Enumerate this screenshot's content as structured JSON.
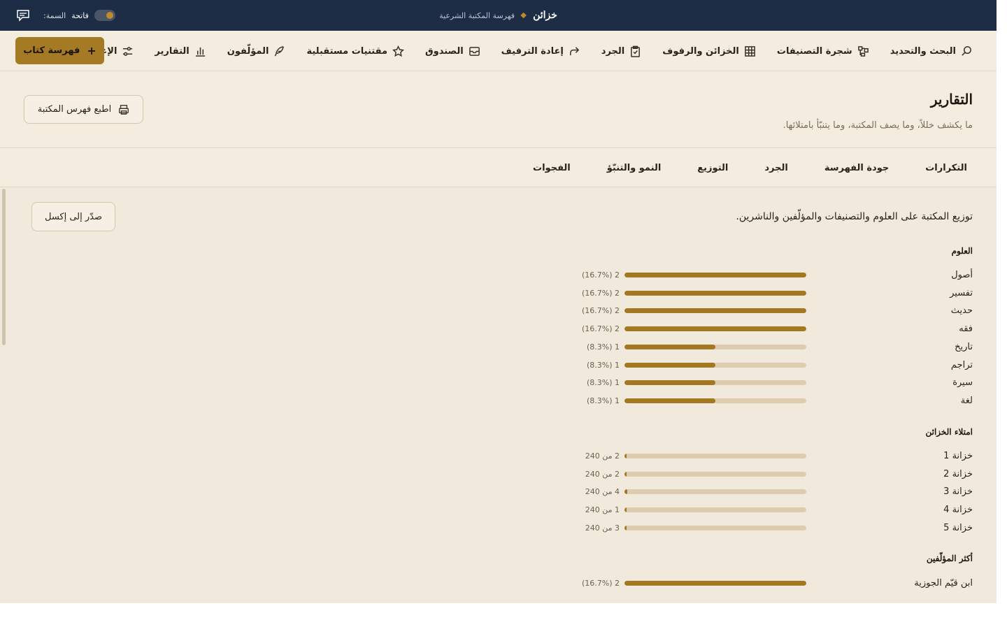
{
  "topbar": {
    "brand_name": "خزائن",
    "brand_subtitle": "فهرسة المكتبة الشرعية",
    "theme_label": "السمة:",
    "theme_value": "فاتحة"
  },
  "nav": {
    "items": [
      {
        "label": "البحث والتحديد",
        "icon": "search-icon"
      },
      {
        "label": "شجرة التصنيفات",
        "icon": "tree-icon"
      },
      {
        "label": "الخزائن والرفوف",
        "icon": "grid-icon"
      },
      {
        "label": "الجرد",
        "icon": "clipboard-check-icon"
      },
      {
        "label": "إعادة الترفيف",
        "icon": "redo-arrow-icon"
      },
      {
        "label": "الصندوق",
        "icon": "inbox-icon"
      },
      {
        "label": "مقتنيات مستقبلية",
        "icon": "star-icon"
      },
      {
        "label": "المؤلّفون",
        "icon": "quill-icon"
      },
      {
        "label": "التقارير",
        "icon": "bar-chart-icon"
      },
      {
        "label": "الإعدادات",
        "icon": "sliders-icon"
      }
    ],
    "primary_button": "فهرسة كتاب"
  },
  "page": {
    "title": "التقارير",
    "subtitle": "ما يكشف خللاً، وما يصف المكتبة، وما يتنبّأ بامتلائها.",
    "print_button": "اطبع فهرس المكتبة"
  },
  "tabs": [
    "التكرارات",
    "جودة الفهرسة",
    "الجرد",
    "التوزيع",
    "النمو والتنبّؤ",
    "الفجوات"
  ],
  "content": {
    "intro": "توزيع المكتبة على العلوم والتصنيفات والمؤلّفين والناشرين.",
    "export_button": "صدّر إلى إكسل"
  },
  "chart_data": [
    {
      "type": "bar",
      "title": "العلوم",
      "categories": [
        "أصول",
        "تفسير",
        "حديث",
        "فقه",
        "تاريخ",
        "تراجم",
        "سيرة",
        "لغة"
      ],
      "values": [
        2,
        2,
        2,
        2,
        1,
        1,
        1,
        1
      ],
      "value_labels": [
        "2 (16.7%)",
        "2 (16.7%)",
        "2 (16.7%)",
        "2 (16.7%)",
        "1 (8.3%)",
        "1 (8.3%)",
        "1 (8.3%)",
        "1 (8.3%)"
      ],
      "fill_fractions": [
        1,
        1,
        1,
        1,
        0.5,
        0.5,
        0.5,
        0.5
      ]
    },
    {
      "type": "bar",
      "title": "امتلاء الخزائن",
      "categories": [
        "خزانة 1",
        "خزانة 2",
        "خزانة 3",
        "خزانة 4",
        "خزانة 5"
      ],
      "values": [
        2,
        2,
        4,
        1,
        3
      ],
      "value_labels": [
        "2 من 240",
        "2 من 240",
        "4 من 240",
        "1 من 240",
        "3 من 240"
      ],
      "fill_fractions": [
        0.00833,
        0.00833,
        0.01667,
        0.00417,
        0.0125
      ]
    },
    {
      "type": "bar",
      "title": "أكثر المؤلّفين",
      "categories": [
        "ابن قيّم الجوزية"
      ],
      "values": [
        2
      ],
      "value_labels": [
        "2 (16.7%)"
      ],
      "fill_fractions": [
        1
      ]
    }
  ],
  "colors": {
    "topbar": "#1c2d45",
    "accent": "#a57a24",
    "background": "#f3ecdf",
    "bar_track": "#ddccaf"
  }
}
